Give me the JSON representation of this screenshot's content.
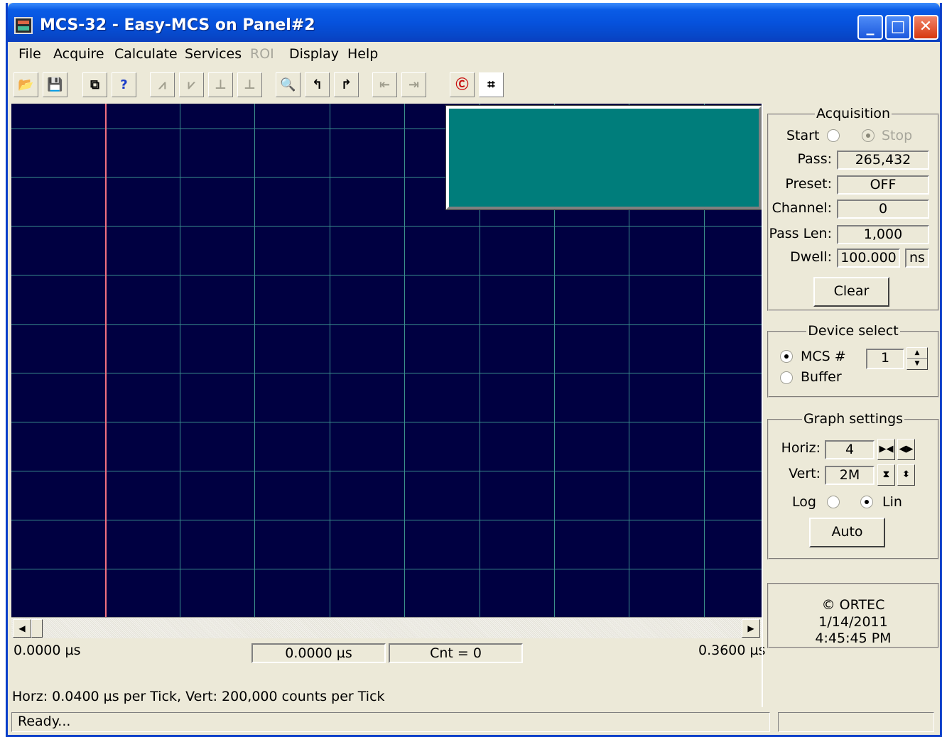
{
  "window": {
    "title": "MCS-32 - Easy-MCS on Panel#2"
  },
  "titlebar_buttons": {
    "minimize": "_",
    "maximize": "□",
    "close": "✕"
  },
  "menu": [
    "File",
    "Acquire",
    "Calculate",
    "Services",
    "ROI",
    "Display",
    "Help"
  ],
  "menu_disabled": [
    "ROI"
  ],
  "toolbar": {
    "icons": [
      "open-icon",
      "save-icon",
      "copy-icon",
      "help-icon",
      "mark-roi-icon",
      "clear-roi-icon",
      "prev-roi-icon",
      "next-roi-icon",
      "zoom-icon",
      "peak-left-icon",
      "peak-right-icon",
      "roi-left-icon",
      "roi-right-icon",
      "crl-icon",
      "full-view-icon"
    ],
    "glyphs": {
      "open": "📂",
      "save": "💾",
      "copy": "⧉",
      "help": "?",
      "crl": "Ⓒ",
      "full_view": "⌗",
      "mark_roi": "⩘",
      "clear_roi": "⩗",
      "prev_roi": "⊥",
      "next_roi": "⊥",
      "zoom": "🔍",
      "peak_left": "↰",
      "peak_right": "↱",
      "roi_left": "⇤",
      "roi_right": "⇥"
    }
  },
  "graph": {
    "x_start": "0.0000 µs",
    "x_end": "0.3600 µs",
    "cursor_value": "0.0000 µs",
    "count": "Cnt = 0",
    "scale_info": "Horz: 0.0400 µs per Tick, Vert: 200,000 counts per Tick",
    "scroll_left": "◀",
    "scroll_right": "▶"
  },
  "acquisition": {
    "title": "Acquisition",
    "start_label": "Start",
    "stop_label": "Stop",
    "pass_label": "Pass:",
    "pass_value": "265,432",
    "preset_label": "Preset:",
    "preset_value": "OFF",
    "channel_label": "Channel:",
    "channel_value": "0",
    "pass_len_label": "Pass Len:",
    "pass_len_value": "1,000",
    "dwell_label": "Dwell:",
    "dwell_value": "100.000",
    "dwell_unit": "ns",
    "clear_button": "Clear"
  },
  "device_select": {
    "title": "Device select",
    "mcs_label": "MCS #",
    "mcs_value": "1",
    "buffer_label": "Buffer",
    "selected": "MCS #"
  },
  "graph_settings": {
    "title": "Graph settings",
    "horiz_label": "Horiz:",
    "horiz_value": "4",
    "vert_label": "Vert:",
    "vert_value": "2M",
    "log_label": "Log",
    "lin_label": "Lin",
    "scale_mode": "Lin",
    "auto_button": "Auto",
    "horiz_btn_narrow": "▶◀",
    "horiz_btn_wide": "◀▶",
    "vert_btn_narrow": "⧗",
    "vert_btn_wide": "⬍"
  },
  "info_box": {
    "copyright": "© ORTEC",
    "date": "1/14/2011",
    "time": "4:45:45 PM"
  },
  "status": {
    "text": "Ready..."
  },
  "colors": {
    "graph_bg": "#000041",
    "grid": "#3a8f8d",
    "cursor": "#f07080",
    "overview_bg": "#007d7b",
    "title_blue": "#0652dd"
  }
}
